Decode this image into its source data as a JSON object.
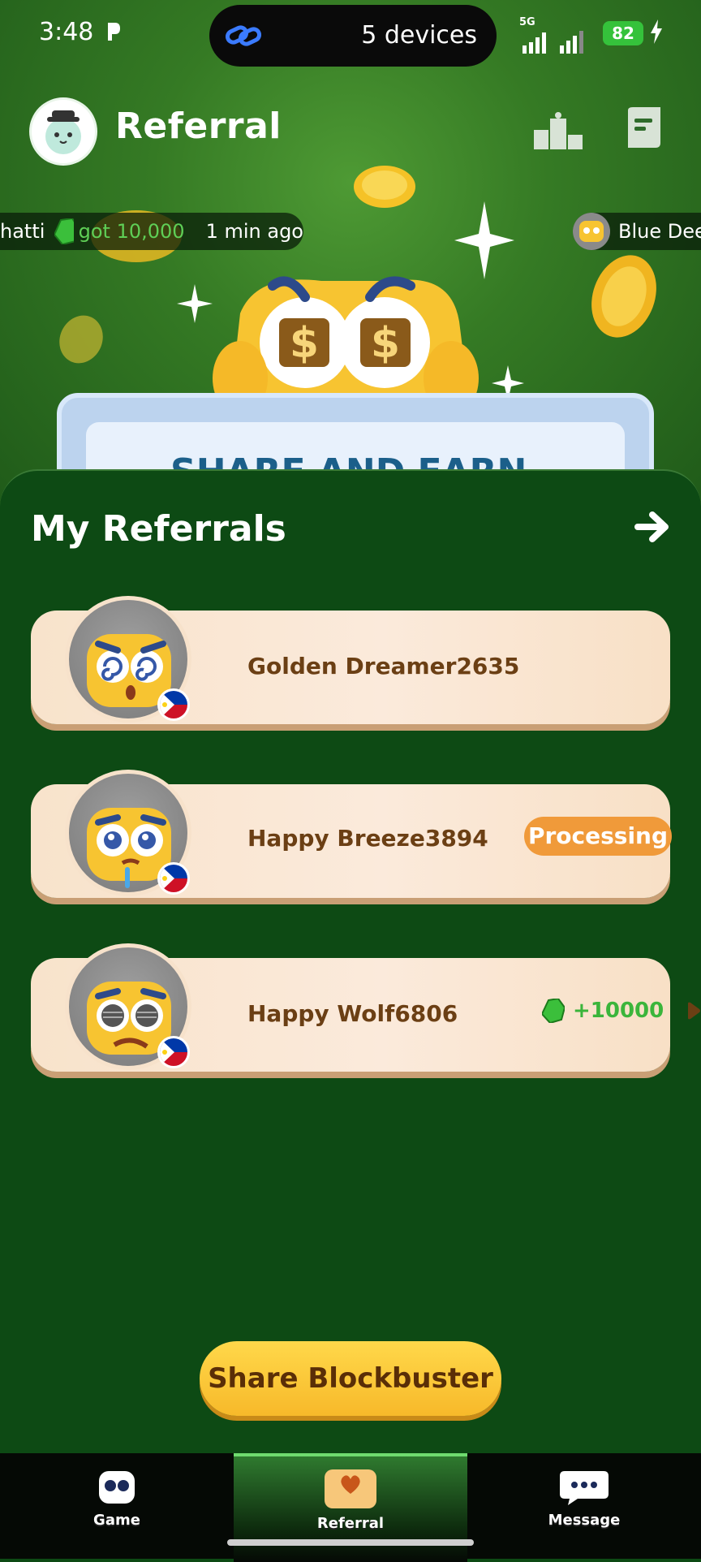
{
  "status_bar": {
    "time": "3:48",
    "devices_text": "5 devices",
    "network": "5G",
    "battery": "82"
  },
  "header": {
    "title": "Referral"
  },
  "ticker": {
    "user_fragment": "hatti",
    "gain_text": "got 10,000",
    "time_ago": "1 min ago",
    "next_user_fragment": "Blue Dee"
  },
  "hero": {
    "banner_text": "SHARE AND EARN"
  },
  "referrals": {
    "title": "My Referrals",
    "items": [
      {
        "name": "Golden Dreamer2635",
        "status": "",
        "reward": ""
      },
      {
        "name": "Happy Breeze3894",
        "status": "Processing",
        "reward": ""
      },
      {
        "name": "Happy Wolf6806",
        "status": "",
        "reward": "+10000"
      }
    ]
  },
  "share_button": {
    "label": "Share Blockbuster"
  },
  "tabs": [
    {
      "label": "Game"
    },
    {
      "label": "Referral"
    },
    {
      "label": "Message"
    }
  ],
  "colors": {
    "accent_green": "#0d4a14",
    "processing_orange": "#f09a3a",
    "reward_green": "#3bb53b",
    "button_yellow": "#f7b92a"
  },
  "icons": {
    "status_p": "p-icon",
    "link": "link-icon",
    "leaderboard": "podium-icon",
    "rules": "book-icon",
    "arrow": "arrow-right-icon",
    "gem": "gem-icon",
    "play": "play-icon"
  }
}
